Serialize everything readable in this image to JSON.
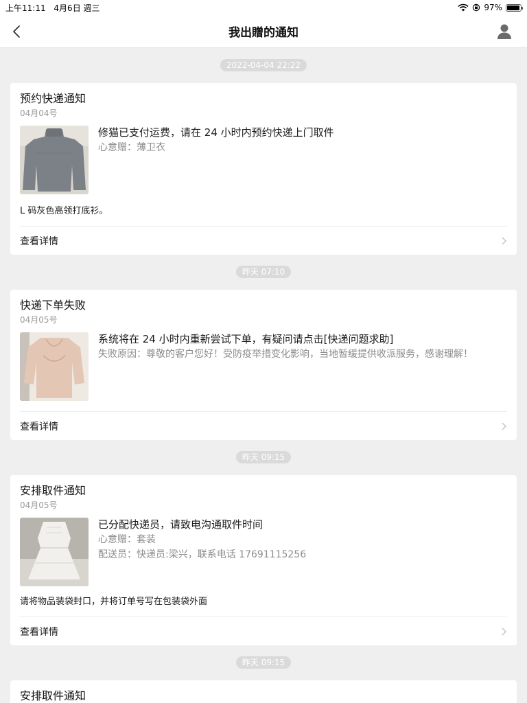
{
  "status_bar": {
    "time": "上午11:11",
    "date": "4月6日 週三",
    "battery_text": "97%",
    "battery_level": 0.97
  },
  "nav": {
    "title": "我出贈的通知",
    "back_icon": "chevron-left-icon",
    "user_icon": "user-icon"
  },
  "groups": [
    {
      "time": "2022-04-04 22:22",
      "card": {
        "title": "预约快递通知",
        "date": "04月04号",
        "image": "gray-turtleneck-photo",
        "main": "修猫已支付运费，请在 24 小时内预约快递上门取件",
        "sub_lines": [
          "心意赠：薄卫衣"
        ],
        "note": "L 码灰色高领打底衫。",
        "detail_label": "查看详情"
      }
    },
    {
      "time": "昨天 07:10",
      "card": {
        "title": "快递下单失败",
        "date": "04月05号",
        "image": "beige-top-photo",
        "main": "系统将在 24 小时内重新尝试下单，有疑问请点击[快递问题求助]",
        "sub_lines": [
          "失败原因：尊敬的客户您好！受防疫举措变化影响，当地暂缓提供收派服务，感谢理解！"
        ],
        "note": "",
        "detail_label": "查看详情"
      }
    },
    {
      "time": "昨天 09:15",
      "card": {
        "title": "安排取件通知",
        "date": "04月05号",
        "image": "white-dress-photo",
        "main": "已分配快递员，请致电沟通取件时间",
        "sub_lines": [
          "心意赠：套装",
          "配送员：快递员:梁兴，联系电话 17691115256"
        ],
        "note": "请将物品装袋封口，并将订单号写在包装袋外面",
        "detail_label": "查看详情"
      }
    },
    {
      "time": "昨天 09:15",
      "card": {
        "title": "安排取件通知"
      }
    }
  ],
  "colors": {
    "background": "#efefef",
    "card": "#ffffff",
    "pill": "#dadada",
    "muted_text": "#8c8c8c"
  }
}
